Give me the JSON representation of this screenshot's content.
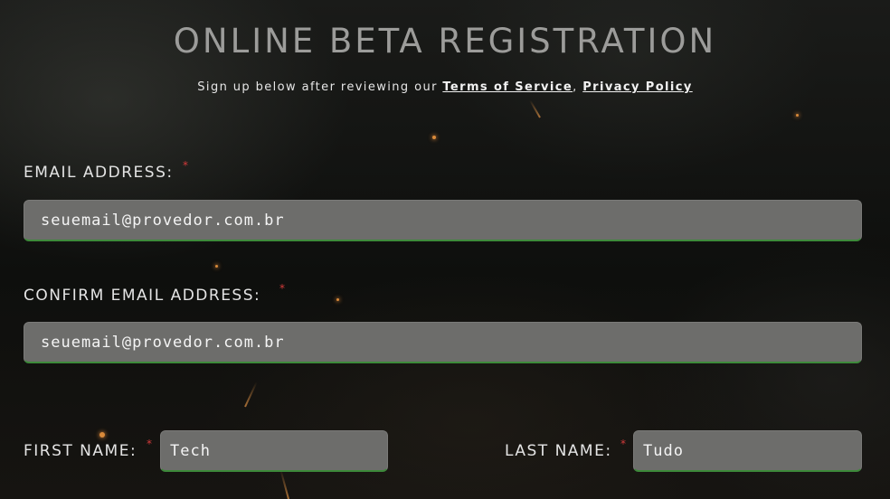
{
  "header": {
    "title": "ONLINE BETA REGISTRATION",
    "subtitle_prefix": "Sign up below after reviewing our",
    "terms_link": "Terms of Service",
    "separator": ",",
    "privacy_link": "Privacy Policy"
  },
  "form": {
    "email": {
      "label": "EMAIL ADDRESS:",
      "required_mark": "*",
      "value": "seuemail@provedor.com.br"
    },
    "confirm_email": {
      "label": "CONFIRM EMAIL ADDRESS:",
      "required_mark": "*",
      "value": "seuemail@provedor.com.br"
    },
    "first_name": {
      "label": "FIRST NAME:",
      "required_mark": "*",
      "value": "Tech"
    },
    "last_name": {
      "label": "LAST NAME:",
      "required_mark": "*",
      "value": "Tudo"
    }
  },
  "colors": {
    "field_background": "#6d6d6b",
    "field_focus_border": "#3d8a3a",
    "required_mark": "#d23a3a",
    "title": "#9c9c9a"
  }
}
